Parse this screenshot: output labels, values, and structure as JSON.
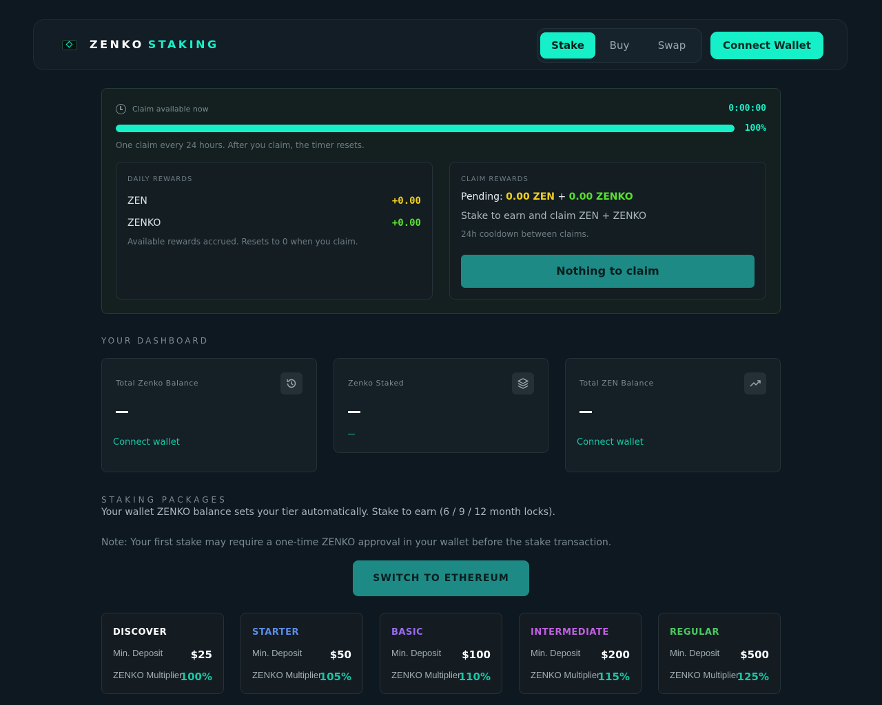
{
  "header": {
    "brand_white": "ZENKO",
    "brand_accent": "STAKING",
    "tabs": [
      "Stake",
      "Buy",
      "Swap"
    ],
    "active_tab": "Stake",
    "connect_label": "Connect Wallet"
  },
  "claim": {
    "status": "Claim available now",
    "timer": "0:00:00",
    "progress_percent": 100,
    "progress_label": "100%",
    "note": "One claim every 24 hours. After you claim, the timer resets.",
    "daily": {
      "title": "DAILY REWARDS",
      "rows": [
        {
          "label": "ZEN",
          "value": "+0.00",
          "color": "#f0d020"
        },
        {
          "label": "ZENKO",
          "value": "+0.00",
          "color": "#58e030"
        }
      ],
      "note": "Available rewards accrued. Resets to 0 when you claim."
    },
    "rewards": {
      "title": "CLAIM REWARDS",
      "pending_prefix": "Pending:",
      "pending_zen": "0.00 ZEN",
      "pending_plus": "+",
      "pending_zenko": "0.00 ZENKO",
      "subtitle": "Stake to earn and claim ZEN + ZENKO",
      "cooldown": "24h cooldown between claims.",
      "button": "Nothing to claim"
    }
  },
  "dashboard": {
    "label": "YOUR DASHBOARD",
    "cards": [
      {
        "title": "Total Zenko Balance",
        "icon": "history-icon",
        "value": "—",
        "link": "Connect wallet"
      },
      {
        "title": "Zenko Staked",
        "icon": "layers-icon",
        "value": "—",
        "link": ""
      },
      {
        "title": "Total ZEN Balance",
        "icon": "trending-up-icon",
        "value": "—",
        "link": "Connect wallet"
      }
    ]
  },
  "packages": {
    "label": "STAKING PACKAGES",
    "subtitle": "Your wallet ZENKO balance sets your tier automatically. Stake to earn (6 / 9 / 12 month locks).",
    "note": "Note: Your first stake may require a one-time ZENKO approval in your wallet before the stake transaction.",
    "switch_button": "SWITCH TO ETHEREUM",
    "deposit_label": "Min. Deposit",
    "multiplier_label": "ZENKO Multiplier",
    "tiers": [
      {
        "name": "DISCOVER",
        "deposit": "$25",
        "multiplier": "100%",
        "color": "#ffffff"
      },
      {
        "name": "STARTER",
        "deposit": "$50",
        "multiplier": "105%",
        "color": "#5b8ce8"
      },
      {
        "name": "BASIC",
        "deposit": "$100",
        "multiplier": "110%",
        "color": "#9a6cf0"
      },
      {
        "name": "INTERMEDIATE",
        "deposit": "$200",
        "multiplier": "115%",
        "color": "#c060e0"
      },
      {
        "name": "REGULAR",
        "deposit": "$500",
        "multiplier": "125%",
        "color": "#4cc860"
      }
    ]
  }
}
